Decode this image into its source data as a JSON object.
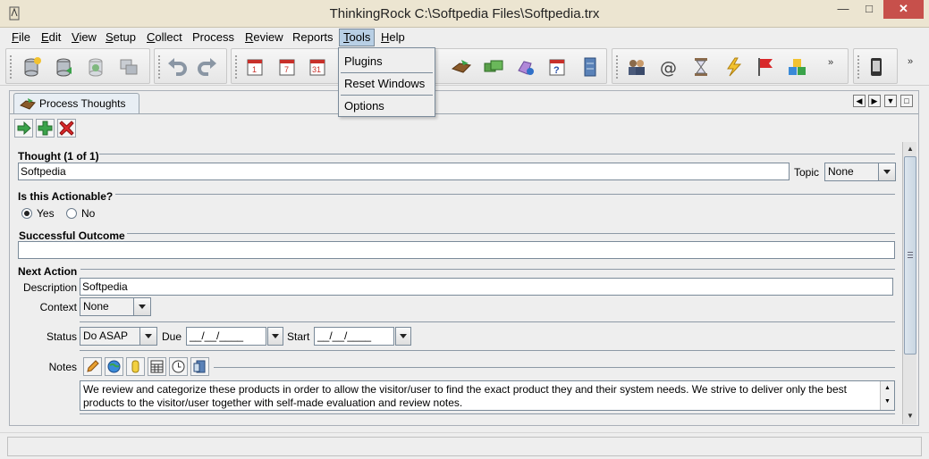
{
  "window": {
    "title": "ThinkingRock C:\\Softpedia Files\\Softpedia.trx",
    "minimize_glyph": "—",
    "maximize_glyph": "□",
    "close_glyph": "✕"
  },
  "menubar": {
    "items": [
      {
        "mnemonic": "F",
        "rest": "ile"
      },
      {
        "mnemonic": "E",
        "rest": "dit"
      },
      {
        "mnemonic": "V",
        "rest": "iew"
      },
      {
        "mnemonic": "S",
        "rest": "etup"
      },
      {
        "mnemonic": "C",
        "rest": "ollect"
      },
      {
        "mnemonic": "",
        "rest": "Process"
      },
      {
        "mnemonic": "R",
        "rest": "eview"
      },
      {
        "mnemonic": "",
        "rest": "Reports"
      },
      {
        "mnemonic": "T",
        "rest": "ools"
      },
      {
        "mnemonic": "H",
        "rest": "elp"
      }
    ],
    "active": "Tools"
  },
  "tools_menu": {
    "items": [
      "Plugins",
      "Reset Windows",
      "Options"
    ]
  },
  "toolbar": {
    "icons": [
      "new-database-icon",
      "open-database-icon",
      "save-database-icon",
      "backup-icon",
      "undo-icon",
      "redo-icon",
      "calendar-day-icon",
      "calendar-week-icon",
      "calendar-month-icon",
      "process-thoughts-icon",
      "organize-icon",
      "print-icon",
      "help-calendar-icon",
      "archive-icon",
      "contacts-icon",
      "email-icon",
      "hourglass-icon",
      "lightning-icon",
      "flag-icon",
      "cubes-icon",
      "device-icon"
    ],
    "more_glyph": "»"
  },
  "tab": {
    "label": "Process Thoughts"
  },
  "form": {
    "thought_title": "Thought (1 of 1)",
    "thought_value": "Softpedia",
    "topic_label": "Topic",
    "topic_value": "None",
    "actionable_title": "Is this Actionable?",
    "yes_label": "Yes",
    "no_label": "No",
    "actionable": "Yes",
    "outcome_title": "Successful Outcome",
    "outcome_value": "",
    "next_action_title": "Next Action",
    "description_label": "Description",
    "description_value": "Softpedia",
    "context_label": "Context",
    "context_value": "None",
    "status_label": "Status",
    "status_value": "Do ASAP",
    "due_label": "Due",
    "due_value": "__/__/____",
    "start_label": "Start",
    "start_value": "__/__/____",
    "notes_label": "Notes",
    "notes_value": "We review and categorize these products in order to allow the visitor/user to find the exact product they and their system needs. We strive to deliver only the best products to the visitor/user together with self-made evaluation and review notes."
  },
  "colors": {
    "accent": "#b8cfe5",
    "close_button": "#c7504b"
  }
}
